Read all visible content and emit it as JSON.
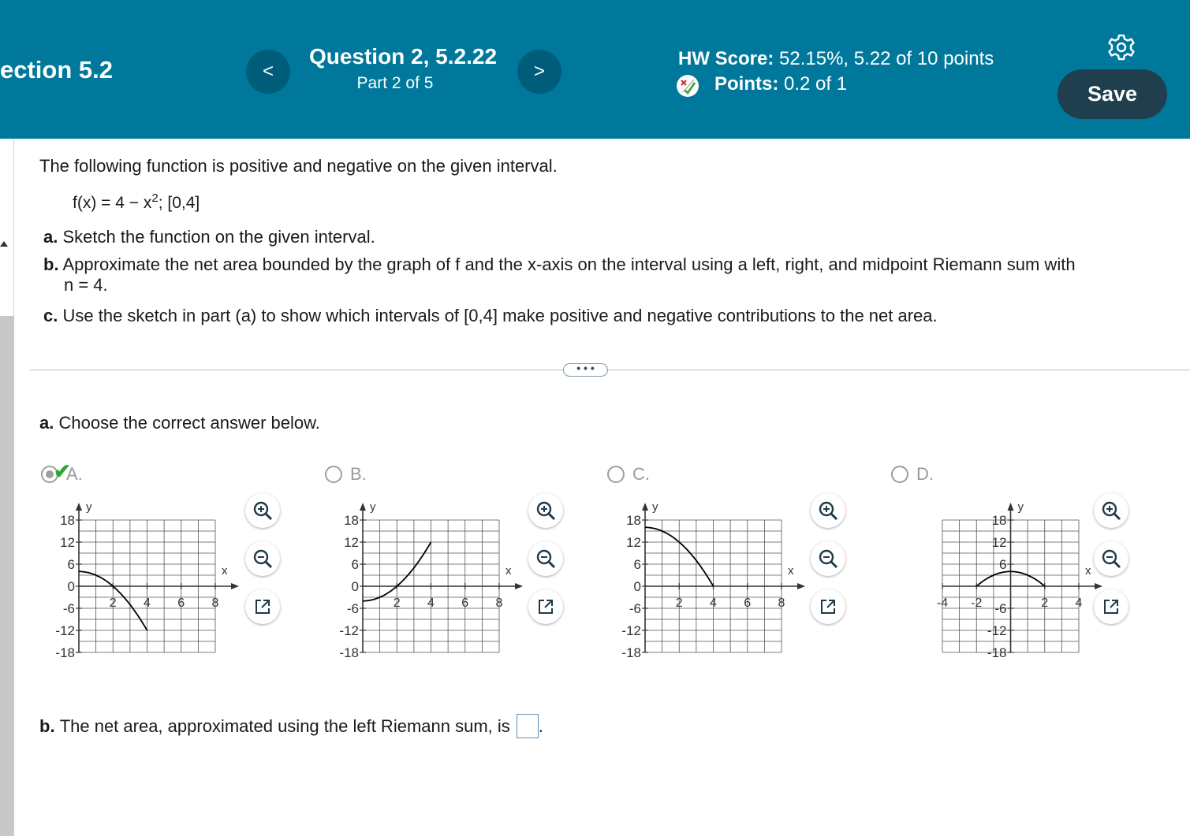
{
  "header": {
    "section": "ection 5.2",
    "prev_label": "<",
    "next_label": ">",
    "question_title": "Question 2, 5.2.22",
    "question_part": "Part 2 of 5",
    "hw_score_label": "HW Score:",
    "hw_score_value": "52.15%, 5.22 of 10 points",
    "points_label": "Points:",
    "points_value": "0.2 of 1",
    "save_label": "Save"
  },
  "problem": {
    "intro": "The following function is positive and negative on the given interval.",
    "function_lhs": "f(x) = 4 − x",
    "function_exp": "2",
    "function_rhs": "; [0,4]",
    "a_label": "a.",
    "a_text": "Sketch the function on the given interval.",
    "b_label": "b.",
    "b_text_line1": "Approximate the net area bounded by the graph of f and the x-axis on the interval using a left, right, and midpoint Riemann sum with",
    "b_text_line2": "n = 4.",
    "c_label": "c.",
    "c_text": "Use the sketch in part (a) to show which intervals of [0,4] make positive and negative contributions to the net area."
  },
  "ellipsis": "• • •",
  "part_a": {
    "label": "a.",
    "prompt": "Choose the correct answer below.",
    "choices": [
      {
        "letter": "A.",
        "selected": true
      },
      {
        "letter": "B.",
        "selected": false
      },
      {
        "letter": "C.",
        "selected": false
      },
      {
        "letter": "D.",
        "selected": false
      }
    ]
  },
  "part_b": {
    "label": "b.",
    "prompt": "The net area, approximated using the left Riemann sum, is",
    "suffix": "."
  },
  "colors": {
    "header_bg": "#00789c",
    "nav_btn": "#005d7a",
    "save_btn": "#1f3f4f",
    "check": "#2fa62f"
  },
  "icons": [
    "chevron-left-icon",
    "chevron-right-icon",
    "gear-icon",
    "partial-credit-icon",
    "zoom-in-icon",
    "zoom-out-icon",
    "external-link-icon",
    "checkmark-icon"
  ],
  "chart_data": [
    {
      "type": "line",
      "choice": "A",
      "xlabel": "x",
      "ylabel": "y",
      "xlim": [
        0,
        8
      ],
      "ylim": [
        -18,
        18
      ],
      "x_ticks": [
        "2",
        "4",
        "6",
        "8"
      ],
      "y_ticks": [
        "18",
        "12",
        "6",
        "0",
        "-6",
        "-12",
        "-18"
      ],
      "function": "4 - x^2",
      "domain": [
        0,
        4
      ],
      "grid": true
    },
    {
      "type": "line",
      "choice": "B",
      "xlabel": "x",
      "ylabel": "y",
      "xlim": [
        0,
        8
      ],
      "ylim": [
        -18,
        18
      ],
      "x_ticks": [
        "2",
        "4",
        "6",
        "8"
      ],
      "y_ticks": [
        "18",
        "12",
        "6",
        "0",
        "-6",
        "-12",
        "-18"
      ],
      "function": "x^2 - 4",
      "domain": [
        0,
        4
      ],
      "grid": true
    },
    {
      "type": "line",
      "choice": "C",
      "xlabel": "x",
      "ylabel": "y",
      "xlim": [
        0,
        8
      ],
      "ylim": [
        -18,
        18
      ],
      "x_ticks": [
        "2",
        "4",
        "6",
        "8"
      ],
      "y_ticks": [
        "18",
        "12",
        "6",
        "0",
        "-6",
        "-12",
        "-18"
      ],
      "function": "16 - x^2 (steep)",
      "domain": [
        0,
        4
      ],
      "grid": true
    },
    {
      "type": "line",
      "choice": "D",
      "xlabel": "x",
      "ylabel": "y",
      "xlim": [
        -4,
        4
      ],
      "ylim": [
        -18,
        18
      ],
      "x_ticks": [
        "-4",
        "-2",
        "2",
        "4"
      ],
      "y_ticks": [
        "18",
        "12",
        "6",
        "-6",
        "-12",
        "-18"
      ],
      "function": "4 - x^2",
      "domain": [
        -2,
        2
      ],
      "grid": true
    }
  ]
}
